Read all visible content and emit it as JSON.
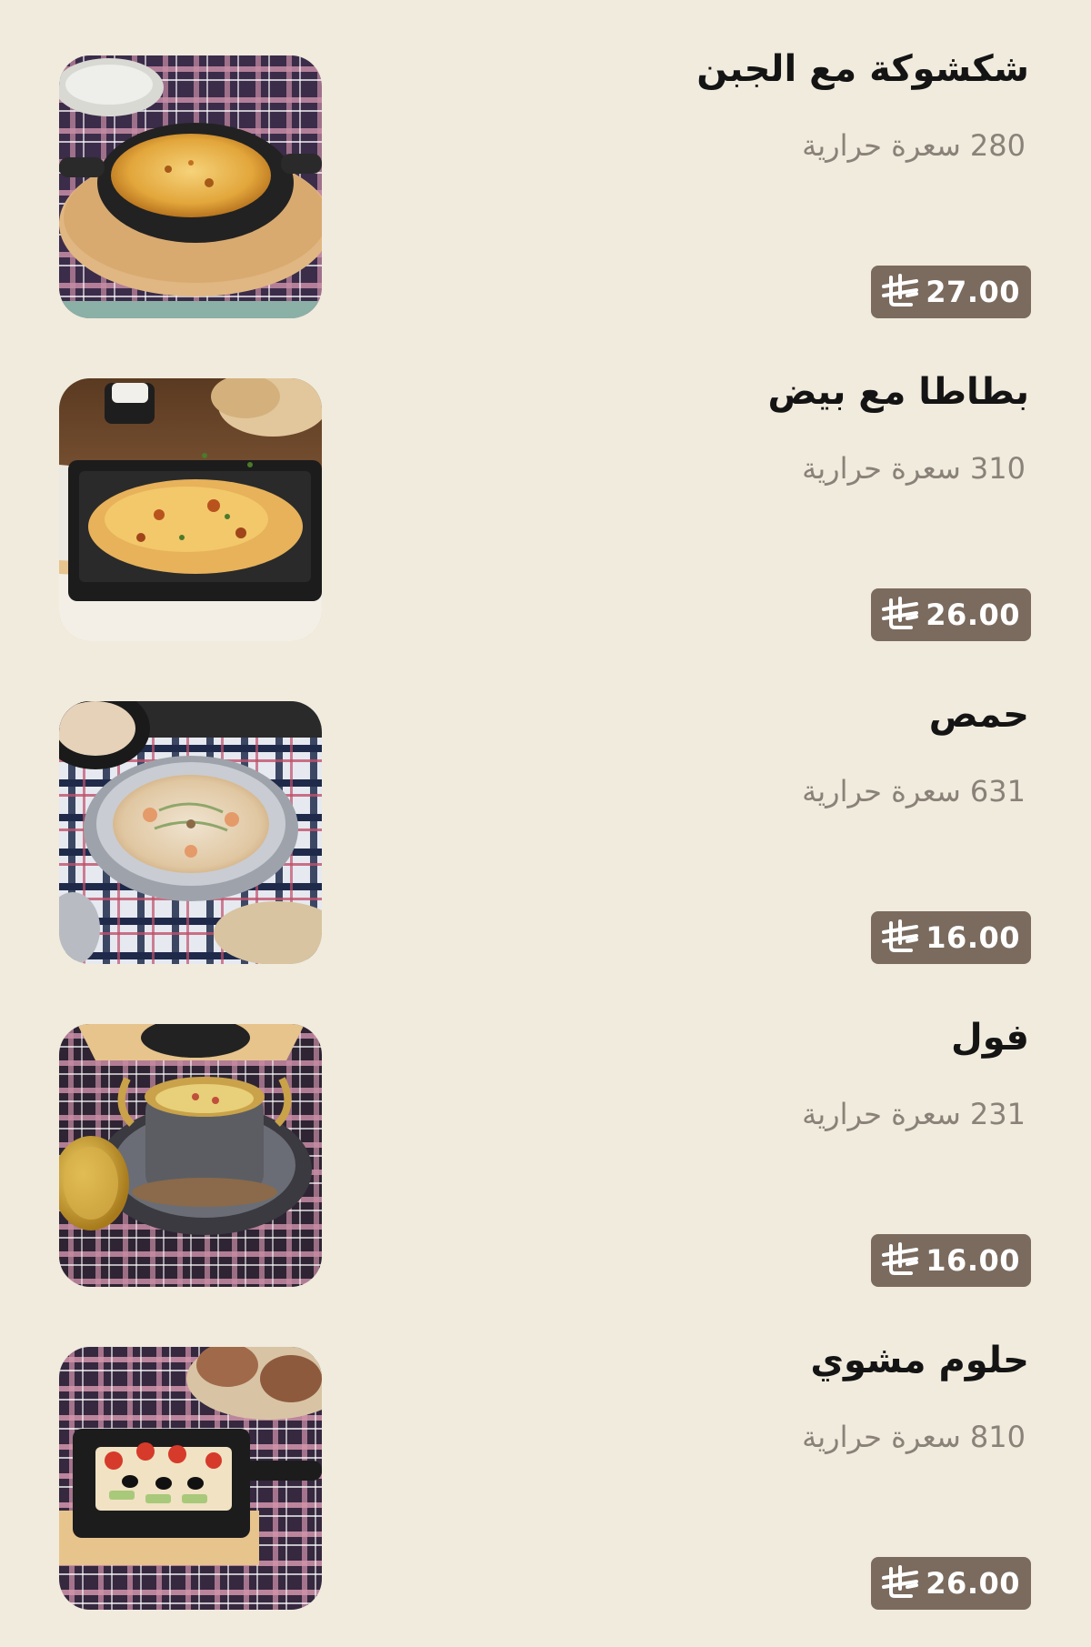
{
  "currency": {
    "icon": "saudi-riyal-icon"
  },
  "colors": {
    "background": "#f0ebdd",
    "price_badge": "#7b6b5e",
    "name_text": "#141414",
    "calorie_text": "#8a8178"
  },
  "items": [
    {
      "name": "شكشوكة مع الجبن",
      "calories": "280 سعرة حرارية",
      "price": "27.00",
      "image": "shakshuka-with-cheese-photo"
    },
    {
      "name": "بطاطا مع بيض",
      "calories": "310 سعرة حرارية",
      "price": "26.00",
      "image": "potato-with-eggs-photo"
    },
    {
      "name": "حمص",
      "calories": "631 سعرة حرارية",
      "price": "16.00",
      "image": "hummus-photo"
    },
    {
      "name": "فول",
      "calories": "231 سعرة حرارية",
      "price": "16.00",
      "image": "foul-photo"
    },
    {
      "name": "حلوم مشوي",
      "calories": "810 سعرة حرارية",
      "price": "26.00",
      "image": "grilled-halloumi-photo"
    }
  ]
}
